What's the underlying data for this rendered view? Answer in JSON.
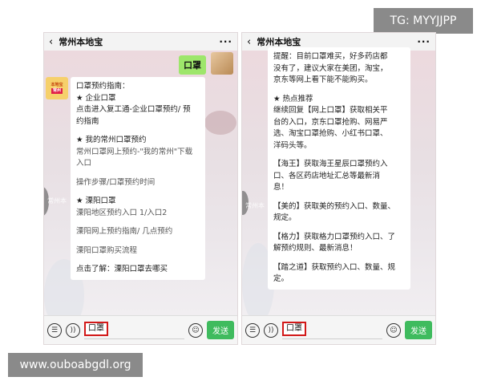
{
  "tg_badge": "TG: MYYJJPP",
  "watermark": "www.ouboabgdl.org",
  "phones": [
    {
      "title": "常州本地宝",
      "sent_message": "口罩",
      "bot_avatar_text": "本地宝",
      "bot_avatar_tag": "常州",
      "side_label": "常州本",
      "bubble_lines": [
        "口罩预约指南：",
        "★ 企业口罩",
        "点击进入复工通-企业口罩预约/ 预",
        "约指南",
        "",
        "★ 我的常州口罩预约",
        "常州口罩网上预约-\"我的常州\"下载",
        "入口",
        "",
        "操作步骤/口罩预约时间",
        "",
        "★ 溧阳口罩",
        "溧阳地区预约入口 1/入口2",
        "",
        "溧阳网上预约指南/ 几点预约",
        "",
        "溧阳口罩购买流程",
        "",
        "点击了解：溧阳口罩去哪买"
      ],
      "input_value": "口罩",
      "send_label": "发送"
    },
    {
      "title": "常州本地宝",
      "side_label": "常州本",
      "bubble_lines": [
        "提醒：目前口罩难买，好多药店都",
        "没有了，建议大家在美团，淘宝，",
        "京东等网上看下能不能购买。",
        "",
        "★ 热点推荐",
        "继续回复【网上口罩】获取相关平",
        "台的入口，京东口罩抢购、网易严",
        "选、淘宝口罩抢购、小红书口罩、",
        "洋码头等。",
        "",
        "【海王】获取海王星辰口罩预约入",
        "口、各区药店地址汇总等最新消",
        "息！",
        "",
        "【美的】获取美的预约入口、数量、",
        "规定。",
        "",
        "【格力】获取格力口罩预约入口、了",
        "解预约规则、最新消息！",
        "",
        "【踏之道】获取预约入口、数量、规",
        "定。"
      ],
      "input_value": "口罩",
      "send_label": "发送"
    }
  ]
}
